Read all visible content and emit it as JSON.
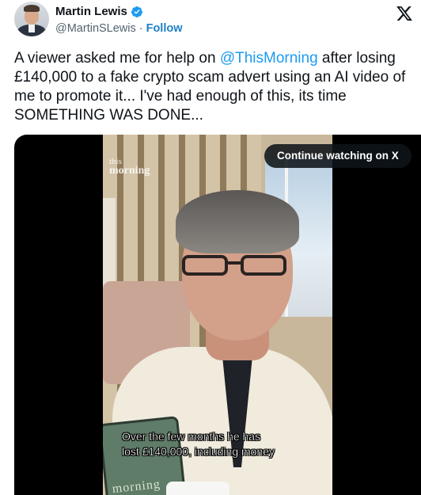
{
  "author": {
    "name": "Martin Lewis",
    "handle": "@MartinSLewis",
    "separator": "·",
    "follow_label": "Follow",
    "verified": true,
    "verified_color": "#1d9bf0"
  },
  "platform": {
    "logo_icon": "x-logo-icon"
  },
  "tweet": {
    "text_before_mention": "A viewer asked me for help on ",
    "mention": "@ThisMorning",
    "text_after_mention": " after losing £140,000 to a fake crypto scam advert using an AI video of me to promote it... I've had enough of this, its time SOMETHING WAS DONE..."
  },
  "video": {
    "continue_label": "Continue watching on X",
    "show_logo_line1": "this",
    "show_logo_line2": "morning",
    "subtitle_line1": "Over the few months he has",
    "subtitle_line2": "lost £140,000, including money",
    "tablet_text": "morning"
  },
  "colors": {
    "link": "#1d9bf0",
    "follow": "#1d7fc8",
    "text": "#0f1419",
    "secondary": "#536471"
  }
}
